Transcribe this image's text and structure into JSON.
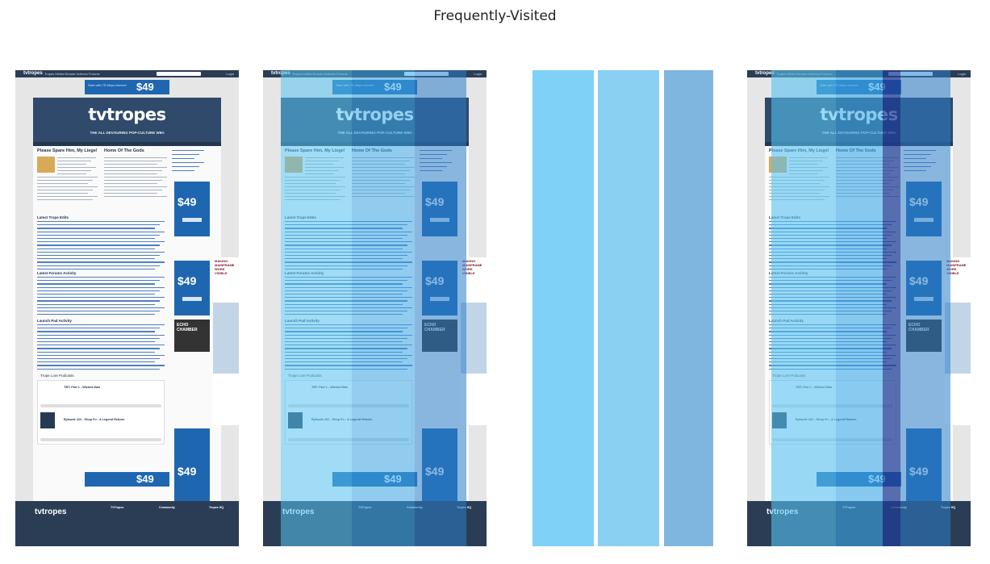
{
  "title": "Frequently-Visited",
  "site": {
    "logo_small": "tvtropes",
    "nav": "Tropes  Media  Browse  Indexes  Forums",
    "login": "Login",
    "brand": "tvtropes",
    "caption": "THE ALL DEVOURING POP-CULTURE WIKI",
    "ad_price": "$49",
    "ad_text": "Start with 75 Mbps internet",
    "feature1_title": "Please Spare Him, My Liege!",
    "feature2_title": "Home Of The Gods",
    "sidebar_links": [
      "Ask The Tropers",
      "Trope Finder",
      "You Know That Show",
      "Trope Launch Pad",
      "Reviews",
      "Lost Media"
    ],
    "section_edits": "Latest Trope Edits",
    "section_forum": "Latest Forums Activity",
    "section_launch": "Launch Pad Activity",
    "section_podcast": "Trope Lore Podcasts",
    "podcast1_title": "TBT: Part 1 - Wicked Man",
    "podcast2_title": "Episode 222 - Shop Fu - A Legend Reborn",
    "side_ad_headline": "MAKING MAINFRAME WORK VISIBLE",
    "echo_ad": "ECHO CHAMBER",
    "footer_logo": "tvtropes",
    "footer_col1": "TVTropes",
    "footer_col2": "Community",
    "footer_col3": "Tropes HQ"
  },
  "heatmap": {
    "panel2_band_colors": [
      "#56c2f0",
      "#3aa6e6",
      "#2c7ec8"
    ],
    "strip_colors": [
      "#7fd1f7",
      "#8ad0f2",
      "#7fb6df"
    ],
    "panel4_band_colors": [
      "#56c2f0",
      "#3aa6e6",
      "#1f3d96"
    ]
  }
}
